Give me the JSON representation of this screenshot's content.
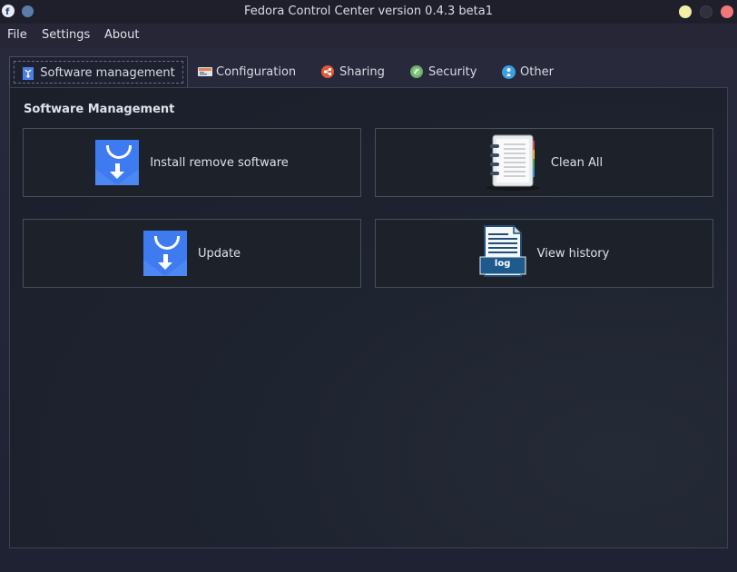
{
  "window": {
    "title": "Fedora Control Center version 0.4.3 beta1"
  },
  "menu": [
    "File",
    "Settings",
    "About"
  ],
  "tabs": [
    {
      "label": "Software management",
      "icon": "software-icon",
      "color": "#4a7fe8"
    },
    {
      "label": "Configuration",
      "icon": "configuration-icon",
      "color": "#e87a4a"
    },
    {
      "label": "Sharing",
      "icon": "sharing-icon",
      "color": "#e05a3a"
    },
    {
      "label": "Security",
      "icon": "security-icon",
      "color": "#6fae6a"
    },
    {
      "label": "Other",
      "icon": "other-icon",
      "color": "#3aa0e0"
    }
  ],
  "active_tab": "Software management",
  "section": {
    "title": "Software Management"
  },
  "buttons": {
    "install": "Install remove software",
    "clean": "Clean All",
    "update": "Update",
    "history": "View history"
  },
  "log_icon_text": "log"
}
